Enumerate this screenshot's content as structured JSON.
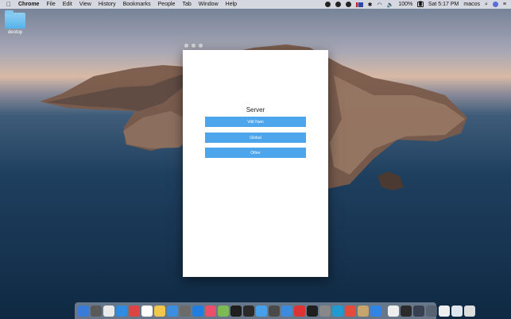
{
  "menubar": {
    "apple": "",
    "app_name": "Chrome",
    "menus": [
      "File",
      "Edit",
      "View",
      "History",
      "Bookmarks",
      "People",
      "Tab",
      "Window",
      "Help"
    ],
    "battery": "100%",
    "clock": "Sat 5:17 PM",
    "user": "macos"
  },
  "desktop": {
    "folder_label": "deotop"
  },
  "app": {
    "title": "Server",
    "buttons": [
      "Việt Nam",
      "Global",
      "Other"
    ]
  },
  "dock": {
    "icon_colors": [
      "#3b7bd8",
      "#5a5a5a",
      "#e9e9e9",
      "#2f8ce0",
      "#d44",
      "#fff",
      "#f3c74e",
      "#3a8fe0",
      "#6b6b6b",
      "#1f7fe0",
      "#ec4f6a",
      "#7db954",
      "#1e1e1e",
      "#2a2a2a",
      "#4aa0e8",
      "#4a4a4a",
      "#3d8bdc",
      "#d33",
      "#1f1f1f",
      "#888",
      "#1f9bd1",
      "#e34b3b",
      "#c8a46f",
      "#2f84e5",
      "#eee",
      "#2b2b2b",
      "#384050",
      "#576371",
      "#eee",
      "#dfe6ef",
      "#ddd"
    ]
  }
}
